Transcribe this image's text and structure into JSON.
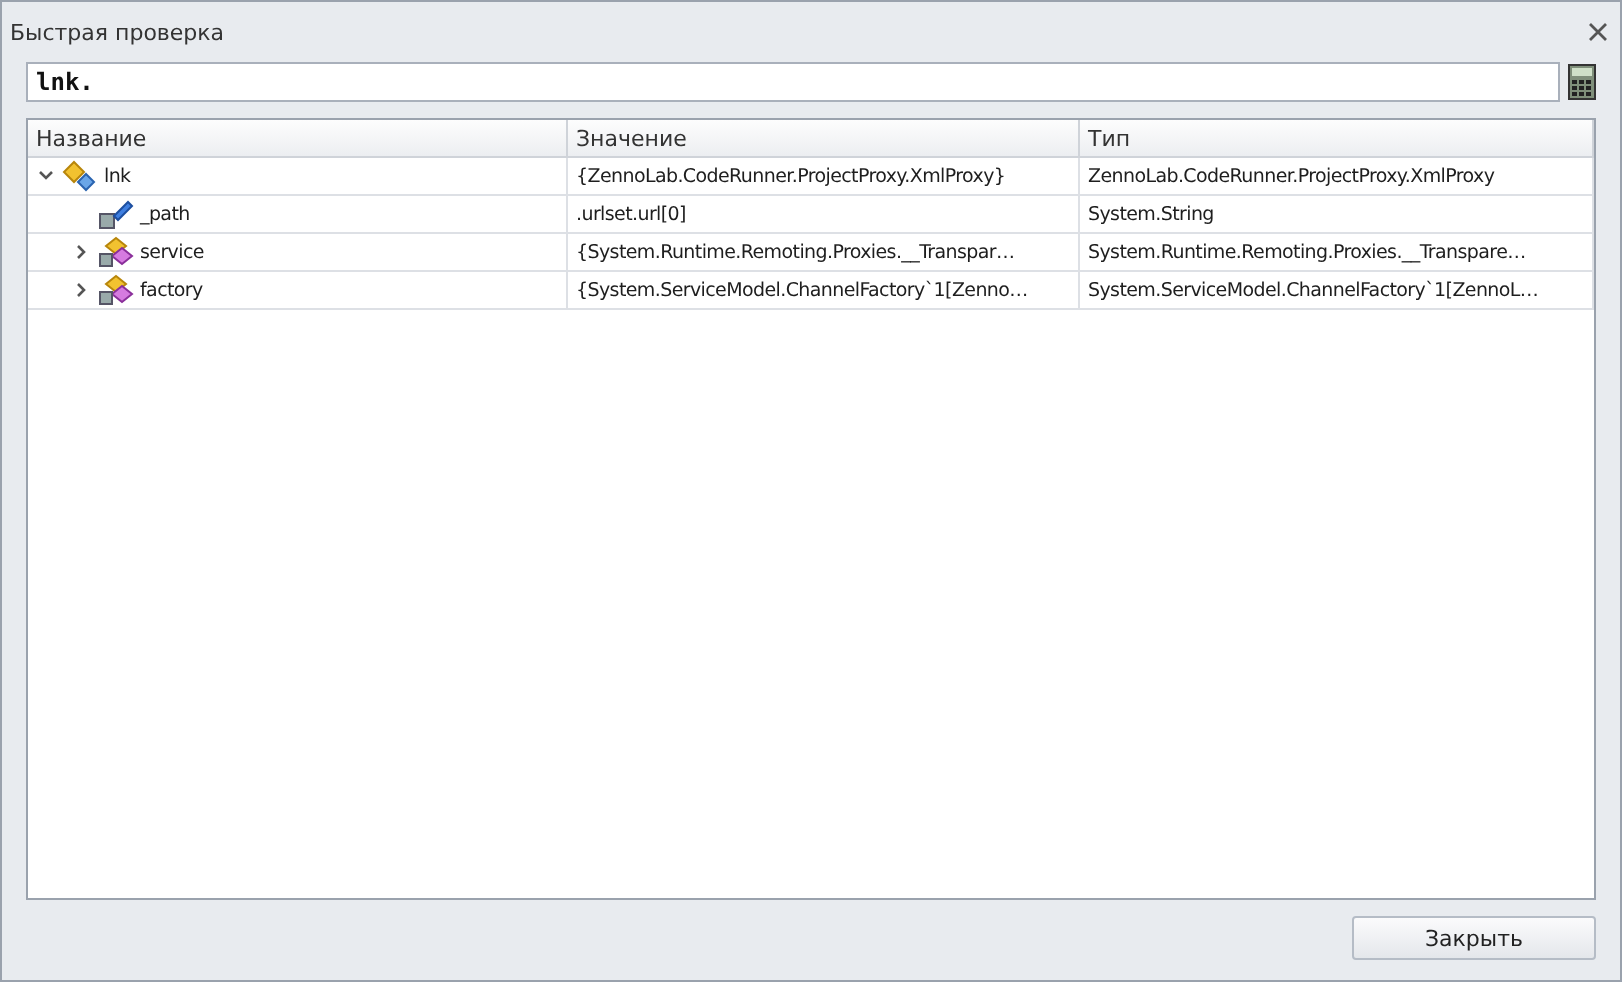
{
  "window": {
    "title": "Быстрая проверка"
  },
  "expression": {
    "value": "lnk."
  },
  "table": {
    "columns": [
      "Название",
      "Значение",
      "Тип"
    ],
    "rows": [
      {
        "name": "lnk",
        "value": "{ZennoLab.CodeRunner.ProjectProxy.XmlProxy}",
        "type": "ZennoLab.CodeRunner.ProjectProxy.XmlProxy",
        "kind": "root",
        "expanded": true,
        "children": [
          {
            "name": "_path",
            "value": ".urlset.url[0]",
            "type": "System.String",
            "kind": "field"
          },
          {
            "name": "service",
            "value": "{System.Runtime.Remoting.Proxies.__Transpar…",
            "type": "System.Runtime.Remoting.Proxies.__Transpare…",
            "kind": "object",
            "expanded": false
          },
          {
            "name": "factory",
            "value": "{System.ServiceModel.ChannelFactory`1[Zenno…",
            "type": "System.ServiceModel.ChannelFactory`1[ZennoL…",
            "kind": "object",
            "expanded": false
          }
        ]
      }
    ]
  },
  "buttons": [
    "Закрыть"
  ]
}
